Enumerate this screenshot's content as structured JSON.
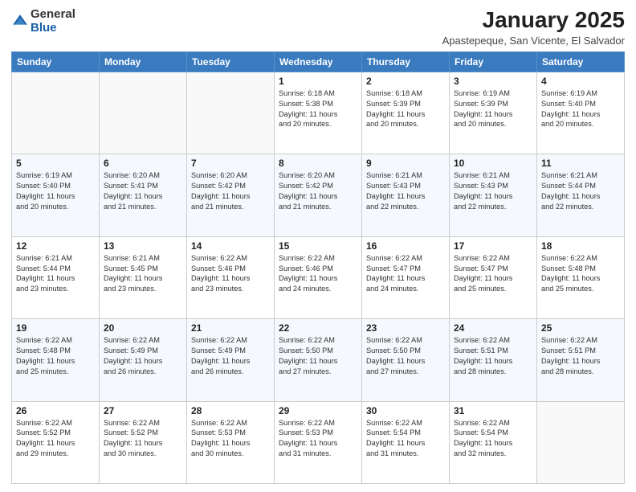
{
  "header": {
    "logo_general": "General",
    "logo_blue": "Blue",
    "month_title": "January 2025",
    "location": "Apastepeque, San Vicente, El Salvador"
  },
  "days_of_week": [
    "Sunday",
    "Monday",
    "Tuesday",
    "Wednesday",
    "Thursday",
    "Friday",
    "Saturday"
  ],
  "weeks": [
    [
      {
        "day": "",
        "info": ""
      },
      {
        "day": "",
        "info": ""
      },
      {
        "day": "",
        "info": ""
      },
      {
        "day": "1",
        "info": "Sunrise: 6:18 AM\nSunset: 5:38 PM\nDaylight: 11 hours\nand 20 minutes."
      },
      {
        "day": "2",
        "info": "Sunrise: 6:18 AM\nSunset: 5:39 PM\nDaylight: 11 hours\nand 20 minutes."
      },
      {
        "day": "3",
        "info": "Sunrise: 6:19 AM\nSunset: 5:39 PM\nDaylight: 11 hours\nand 20 minutes."
      },
      {
        "day": "4",
        "info": "Sunrise: 6:19 AM\nSunset: 5:40 PM\nDaylight: 11 hours\nand 20 minutes."
      }
    ],
    [
      {
        "day": "5",
        "info": "Sunrise: 6:19 AM\nSunset: 5:40 PM\nDaylight: 11 hours\nand 20 minutes."
      },
      {
        "day": "6",
        "info": "Sunrise: 6:20 AM\nSunset: 5:41 PM\nDaylight: 11 hours\nand 21 minutes."
      },
      {
        "day": "7",
        "info": "Sunrise: 6:20 AM\nSunset: 5:42 PM\nDaylight: 11 hours\nand 21 minutes."
      },
      {
        "day": "8",
        "info": "Sunrise: 6:20 AM\nSunset: 5:42 PM\nDaylight: 11 hours\nand 21 minutes."
      },
      {
        "day": "9",
        "info": "Sunrise: 6:21 AM\nSunset: 5:43 PM\nDaylight: 11 hours\nand 22 minutes."
      },
      {
        "day": "10",
        "info": "Sunrise: 6:21 AM\nSunset: 5:43 PM\nDaylight: 11 hours\nand 22 minutes."
      },
      {
        "day": "11",
        "info": "Sunrise: 6:21 AM\nSunset: 5:44 PM\nDaylight: 11 hours\nand 22 minutes."
      }
    ],
    [
      {
        "day": "12",
        "info": "Sunrise: 6:21 AM\nSunset: 5:44 PM\nDaylight: 11 hours\nand 23 minutes."
      },
      {
        "day": "13",
        "info": "Sunrise: 6:21 AM\nSunset: 5:45 PM\nDaylight: 11 hours\nand 23 minutes."
      },
      {
        "day": "14",
        "info": "Sunrise: 6:22 AM\nSunset: 5:46 PM\nDaylight: 11 hours\nand 23 minutes."
      },
      {
        "day": "15",
        "info": "Sunrise: 6:22 AM\nSunset: 5:46 PM\nDaylight: 11 hours\nand 24 minutes."
      },
      {
        "day": "16",
        "info": "Sunrise: 6:22 AM\nSunset: 5:47 PM\nDaylight: 11 hours\nand 24 minutes."
      },
      {
        "day": "17",
        "info": "Sunrise: 6:22 AM\nSunset: 5:47 PM\nDaylight: 11 hours\nand 25 minutes."
      },
      {
        "day": "18",
        "info": "Sunrise: 6:22 AM\nSunset: 5:48 PM\nDaylight: 11 hours\nand 25 minutes."
      }
    ],
    [
      {
        "day": "19",
        "info": "Sunrise: 6:22 AM\nSunset: 5:48 PM\nDaylight: 11 hours\nand 25 minutes."
      },
      {
        "day": "20",
        "info": "Sunrise: 6:22 AM\nSunset: 5:49 PM\nDaylight: 11 hours\nand 26 minutes."
      },
      {
        "day": "21",
        "info": "Sunrise: 6:22 AM\nSunset: 5:49 PM\nDaylight: 11 hours\nand 26 minutes."
      },
      {
        "day": "22",
        "info": "Sunrise: 6:22 AM\nSunset: 5:50 PM\nDaylight: 11 hours\nand 27 minutes."
      },
      {
        "day": "23",
        "info": "Sunrise: 6:22 AM\nSunset: 5:50 PM\nDaylight: 11 hours\nand 27 minutes."
      },
      {
        "day": "24",
        "info": "Sunrise: 6:22 AM\nSunset: 5:51 PM\nDaylight: 11 hours\nand 28 minutes."
      },
      {
        "day": "25",
        "info": "Sunrise: 6:22 AM\nSunset: 5:51 PM\nDaylight: 11 hours\nand 28 minutes."
      }
    ],
    [
      {
        "day": "26",
        "info": "Sunrise: 6:22 AM\nSunset: 5:52 PM\nDaylight: 11 hours\nand 29 minutes."
      },
      {
        "day": "27",
        "info": "Sunrise: 6:22 AM\nSunset: 5:52 PM\nDaylight: 11 hours\nand 30 minutes."
      },
      {
        "day": "28",
        "info": "Sunrise: 6:22 AM\nSunset: 5:53 PM\nDaylight: 11 hours\nand 30 minutes."
      },
      {
        "day": "29",
        "info": "Sunrise: 6:22 AM\nSunset: 5:53 PM\nDaylight: 11 hours\nand 31 minutes."
      },
      {
        "day": "30",
        "info": "Sunrise: 6:22 AM\nSunset: 5:54 PM\nDaylight: 11 hours\nand 31 minutes."
      },
      {
        "day": "31",
        "info": "Sunrise: 6:22 AM\nSunset: 5:54 PM\nDaylight: 11 hours\nand 32 minutes."
      },
      {
        "day": "",
        "info": ""
      }
    ]
  ]
}
